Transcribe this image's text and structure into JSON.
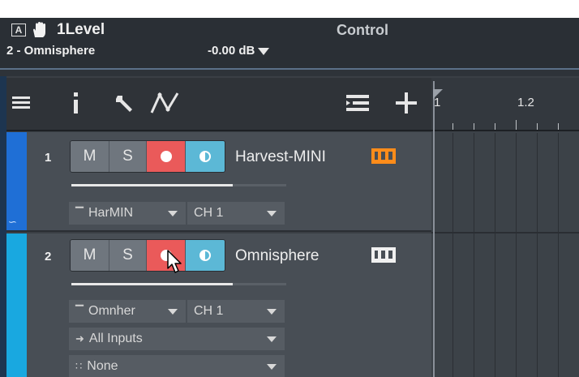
{
  "header": {
    "title": "1Level",
    "subtitle": "2 - Omnisphere",
    "mode": "Control",
    "gain": "-0.00 dB",
    "a_box": "A"
  },
  "ruler": {
    "labels": [
      "1",
      "1.2"
    ]
  },
  "tracks": [
    {
      "number": "1",
      "name": "Harvest-MINI",
      "mute": "M",
      "solo": "S",
      "instrument": "HarMIN",
      "channel": "CH 1",
      "color": "#1f6fd6",
      "piano_color": "#ff8c1a",
      "fader_level": 0.75
    },
    {
      "number": "2",
      "name": "Omnisphere",
      "mute": "M",
      "solo": "S",
      "instrument": "Omnher",
      "channel": "CH 1",
      "input": "All Inputs",
      "output": "None",
      "color": "#19a8e0",
      "piano_color": "#f0f0f0",
      "fader_level": 0.75
    }
  ],
  "icons": [
    "list-icon",
    "info-icon",
    "wrench-icon",
    "automation-icon",
    "track-list-icon",
    "add-icon",
    "hand-icon",
    "piano-icon",
    "arrow-input-icon",
    "mixer-icon"
  ]
}
